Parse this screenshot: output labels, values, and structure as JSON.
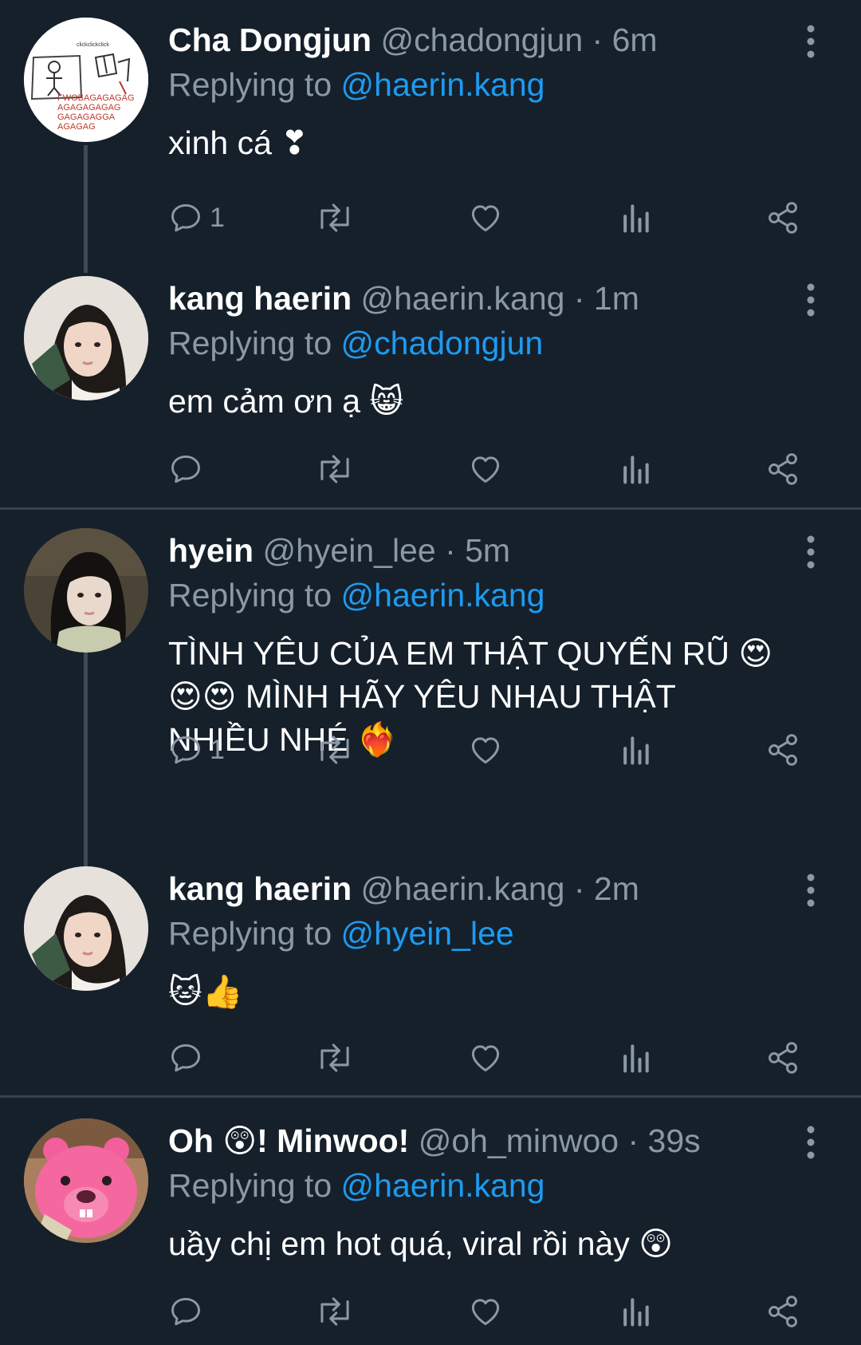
{
  "colors": {
    "background": "#15202b",
    "text": "#ffffff",
    "muted": "#8b98a5",
    "link": "#1d9bf0",
    "divider": "#38444d"
  },
  "tweets": [
    {
      "display_name": "Cha Dongjun",
      "handle": "@chadongjun",
      "separator": "·",
      "time": "6m",
      "replying_prefix": "Replying to",
      "replying_to": "@haerin.kang",
      "text": "xinh cá ❣",
      "reply_count": "1",
      "avatar": "sketch-drawing-avatar",
      "avatar_text": [
        "clickclickclick",
        "FWOBAGAGAGAG",
        "AGAGAGAGAG",
        "GAGAGAGGA",
        "AGAGAG"
      ]
    },
    {
      "display_name": "kang haerin",
      "handle": "@haerin.kang",
      "separator": "·",
      "time": "1m",
      "replying_prefix": "Replying to",
      "replying_to": "@chadongjun",
      "text": "em cảm ơn ạ 😸",
      "reply_count": "",
      "avatar": "portrait-avatar"
    },
    {
      "display_name": "hyein",
      "handle": "@hyein_lee",
      "separator": "·",
      "time": "5m",
      "replying_prefix": "Replying to",
      "replying_to": "@haerin.kang",
      "text": "TÌNH YÊU CỦA EM THẬT QUYẾN RŨ 😍\n😍😍 MÌNH HÃY YÊU NHAU THẬT\nNHIỀU NHÉ ❤️‍🔥",
      "reply_count": "1",
      "avatar": "portrait-avatar"
    },
    {
      "display_name": "kang haerin",
      "handle": "@haerin.kang",
      "separator": "·",
      "time": "2m",
      "replying_prefix": "Replying to",
      "replying_to": "@hyein_lee",
      "text": "🐱👍",
      "reply_count": "",
      "avatar": "portrait-avatar"
    },
    {
      "display_name": "Oh 😲! Minwoo!",
      "handle": "@oh_minwoo",
      "separator": "·",
      "time": "39s",
      "replying_prefix": "Replying to",
      "replying_to": "@haerin.kang",
      "text": "uầy chị em hot quá, viral rồi này 😲",
      "reply_count": "",
      "avatar": "pink-beaver-avatar"
    }
  ],
  "icons": {
    "reply": "reply-icon",
    "retweet": "retweet-icon",
    "like": "heart-icon",
    "views": "views-icon",
    "share": "share-icon",
    "more": "more-vertical-icon"
  }
}
